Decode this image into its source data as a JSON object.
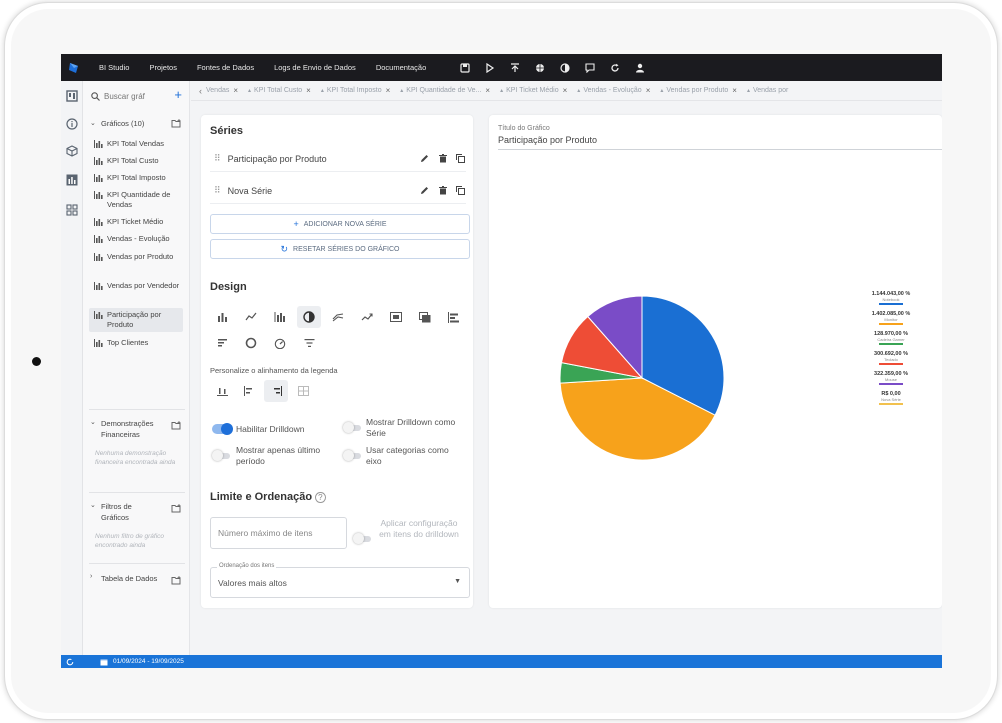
{
  "topbar": {
    "nav": [
      "BI Studio",
      "Projetos",
      "Fontes de Dados",
      "Logs de Envio de Dados",
      "Documentação"
    ],
    "icons": [
      "save-icon",
      "play-icon",
      "publish-icon",
      "globe-icon",
      "theme-icon",
      "comment-icon",
      "refresh-icon",
      "user-icon"
    ]
  },
  "sidebar": {
    "search_placeholder": "Buscar gráf",
    "graficos": {
      "label": "Gráficos (10)",
      "items": [
        "KPI Total Vendas",
        "KPI Total Custo",
        "KPI Total Imposto",
        "KPI Quantidade de Vendas",
        "KPI Ticket Médio",
        "Vendas - Evolução",
        "Vendas por Produto",
        "Vendas por Vendedor",
        "Participação por Produto",
        "Top Clientes"
      ]
    },
    "demonstracoes": {
      "label": "Demonstrações Financeiras",
      "empty": "Nenhuma demonstração financeira encontrada ainda"
    },
    "filtros": {
      "label": "Filtros de Gráficos",
      "empty": "Nenhum filtro de gráfico encontrado ainda"
    },
    "tabela": {
      "label": "Tabela de Dados"
    }
  },
  "tabs": [
    "Vendas",
    "KPI Total Custo",
    "KPI Total Imposto",
    "KPI Quantidade de Ve...",
    "KPI Ticket Médio",
    "Vendas - Evolução",
    "Vendas por Produto",
    "Vendas por"
  ],
  "panel": {
    "series_title": "Séries",
    "series": [
      "Participação por Produto",
      "Nova Série"
    ],
    "add_series": "ADICIONAR NOVA SÉRIE",
    "reset_series": "RESETAR SÉRIES DO GRÁFICO",
    "design_title": "Design",
    "legend_label": "Personalize o alinhamento da legenda",
    "toggles": {
      "drilldown": "Habilitar Drilldown",
      "drilldown_series": "Mostrar Drilldown como Série",
      "last_period": "Mostrar apenas último período",
      "categories_axis": "Usar categorias como eixo"
    },
    "limit_title": "Limite e Ordenação",
    "max_items_placeholder": "Número máximo de itens",
    "apply_drilldown": "Aplicar configuração em itens do drilldown",
    "order_legend": "Ordenação dos itens",
    "order_value": "Valores mais altos"
  },
  "chart_card": {
    "title_label": "Título do Gráfico",
    "title_value": "Participação por Produto"
  },
  "chart_data": {
    "type": "pie",
    "title": "Participação por Produto",
    "slices": [
      {
        "value": 32.5,
        "color": "#1a6fd3"
      },
      {
        "value": 41.5,
        "color": "#f7a21b"
      },
      {
        "value": 4.0,
        "color": "#3aa455"
      },
      {
        "value": 10.5,
        "color": "#ee4d36"
      },
      {
        "value": 11.5,
        "color": "#7a4cc7"
      }
    ],
    "legend": [
      {
        "value": "1.144.043,00 %",
        "name": "Notebook",
        "color": "#1a6fd3"
      },
      {
        "value": "1.402.085,00 %",
        "name": "Monitor",
        "color": "#f7a21b"
      },
      {
        "value": "128.970,00 %",
        "name": "Cadeira Gamer",
        "color": "#3aa455"
      },
      {
        "value": "300.692,00 %",
        "name": "Teclado",
        "color": "#ee4d36"
      },
      {
        "value": "322.359,00 %",
        "name": "Mouse",
        "color": "#7a4cc7"
      },
      {
        "value": "R$ 0,00",
        "name": "Nova Série",
        "color": "#f2c14e"
      }
    ]
  },
  "status": {
    "date_range": "01/09/2024 - 19/09/2025"
  }
}
